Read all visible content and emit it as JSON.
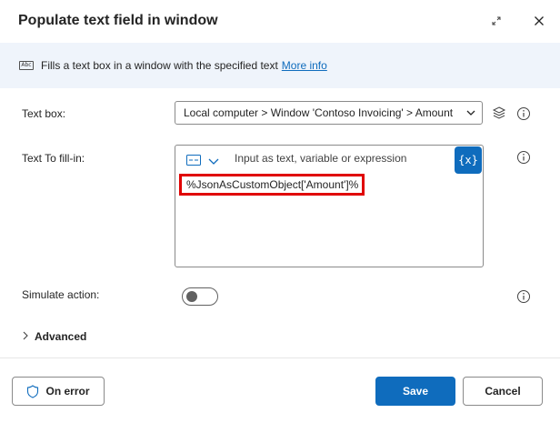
{
  "dialog": {
    "title": "Populate text field in window"
  },
  "banner": {
    "icon": "textbox-icon",
    "icon_text": "Abc",
    "description": "Fills a text box in a window with the specified text",
    "more_info": "More info"
  },
  "text_box": {
    "label": "Text box:",
    "value": "Local computer > Window 'Contoso Invoicing' > Amount"
  },
  "text_to_fill": {
    "label": "Text To fill-in:",
    "mode_hint": "Input as text, variable or expression",
    "variable_button": "{x}",
    "value": "%JsonAsCustomObject['Amount']%"
  },
  "simulate_action": {
    "label": "Simulate action:",
    "enabled": false
  },
  "advanced": {
    "label": "Advanced"
  },
  "footer": {
    "on_error": "On error",
    "save": "Save",
    "cancel": "Cancel"
  },
  "colors": {
    "accent": "#0f6cbd",
    "banner_bg": "#eff4fb",
    "highlight_border": "#e00000"
  }
}
